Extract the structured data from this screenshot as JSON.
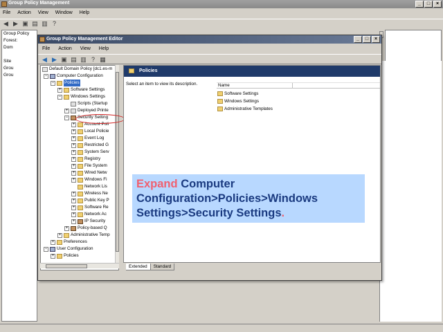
{
  "outer_window": {
    "title": "Group Policy Management",
    "controls": [
      "_",
      "□",
      "×"
    ],
    "menu": [
      "File",
      "Action",
      "View",
      "Window",
      "Help"
    ],
    "tree": [
      "Group Policy",
      "Forest:",
      "Dom",
      "Site",
      "Grou",
      "Grou"
    ]
  },
  "inner_window": {
    "title": "Group Policy Management Editor",
    "controls": [
      "_",
      "□",
      "×"
    ],
    "menu": [
      "File",
      "Action",
      "View",
      "Help"
    ],
    "tree": {
      "root": "Default Domain Policy [dc1.es-m",
      "computer_configuration": "Computer Configuration",
      "policies": "Policies",
      "software_settings": "Software Settings",
      "windows_settings": "Windows Settings",
      "scripts": "Scripts (Startup",
      "deployed_printers": "Deployed Printe",
      "security_settings": "Security Setting",
      "sec_children": [
        "Account Poli",
        "Local Policie",
        "Event Log",
        "Restricted G",
        "System Serv",
        "Registry",
        "File System",
        "Wired Netw",
        "Windows Fi",
        "Network Lis",
        "Wireless Ne",
        "Public Key P",
        "Software Re",
        "Network Ac",
        "IP Security",
        "Policy-based Q"
      ],
      "admin_templates": "Administrative Temp",
      "preferences": "Preferences",
      "user_configuration": "User Configuration",
      "user_policies": "Policies"
    },
    "detail": {
      "header": "Policies",
      "description": "Select an item to view its description.",
      "column_name": "Name",
      "items": [
        "Software Settings",
        "Windows Settings",
        "Administrative Templates"
      ]
    },
    "tabs": [
      "Extended",
      "Standard"
    ]
  },
  "caption": {
    "part1": "Expand",
    "part2": " Computer Configuration>Policies>Windows Settings>Security Settings",
    "part3": "."
  },
  "colors": {
    "header_bg": "#1f3a6a",
    "caption_bg": "#b8d8ff",
    "caption_text": "#1a3a80",
    "highlight": "#f06070",
    "ellipse": "#d02020"
  }
}
